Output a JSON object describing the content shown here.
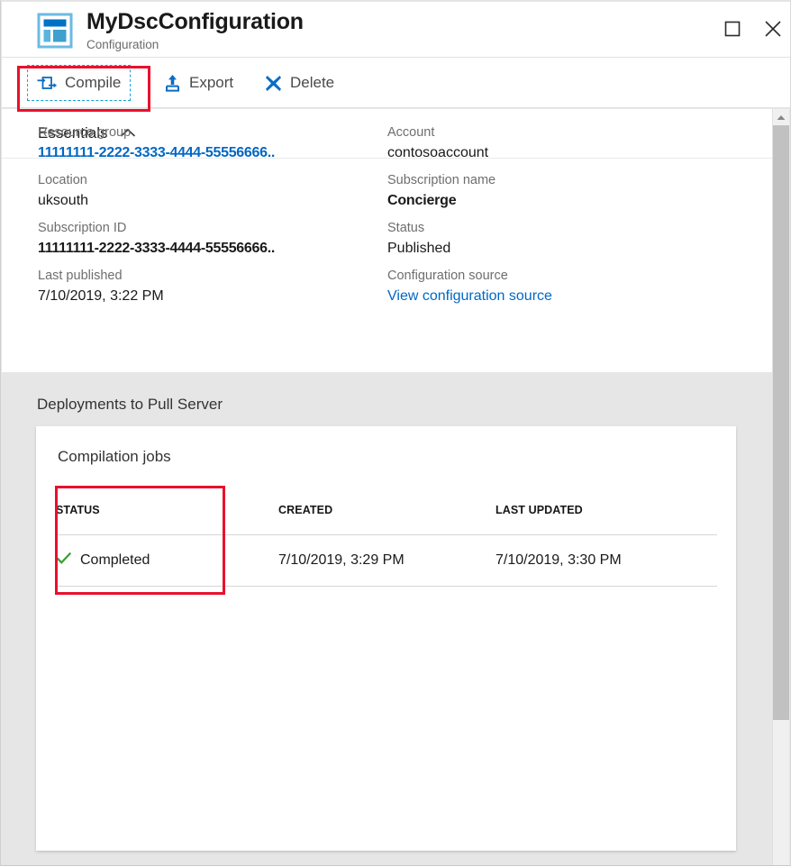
{
  "window": {
    "title": "MyDscConfiguration",
    "subtitle": "Configuration",
    "maximize_label": "Maximize",
    "close_label": "Close"
  },
  "toolbar": {
    "items": [
      {
        "label": "Compile",
        "icon": "compile-icon"
      },
      {
        "label": "Export",
        "icon": "upload-icon"
      },
      {
        "label": "Delete",
        "icon": "x-icon"
      }
    ]
  },
  "essentials": {
    "header": "Essentials",
    "chevron": "chevron-up-icon",
    "left_properties": [
      {
        "label": "Resource group",
        "value": "11111111-2222-3333-4444-55556666..",
        "style": "linkbold"
      },
      {
        "label": "Location",
        "value": "uksouth",
        "style": "plain"
      },
      {
        "label": "Subscription ID",
        "value": "11111111-2222-3333-4444-55556666..",
        "style": "bold"
      },
      {
        "label": "Last published",
        "value": "7/10/2019, 3:22 PM",
        "style": "plain"
      }
    ],
    "right_properties": [
      {
        "label": "Account",
        "value": "contosoaccount",
        "style": "plain"
      },
      {
        "label": "Subscription name",
        "value": "Concierge",
        "style": "strongnarrow"
      },
      {
        "label": "Status",
        "value": "Published",
        "style": "plain"
      },
      {
        "label": "Configuration source",
        "value": "View configuration source",
        "style": "link"
      }
    ]
  },
  "deployments": {
    "section_title": "Deployments to Pull Server",
    "card_title": "Compilation jobs",
    "table": {
      "columns": [
        "STATUS",
        "CREATED",
        "LAST UPDATED"
      ],
      "rows": [
        {
          "status": "Completed",
          "status_icon": "check-icon",
          "created": "7/10/2019, 3:29 PM",
          "last_updated": "7/10/2019, 3:30 PM"
        }
      ]
    }
  },
  "colors": {
    "accent_blue": "#0067c5",
    "link_blue": "#0067c5",
    "annotation_red": "#e8112d",
    "focus_outline": "#16a0d8",
    "success_green": "#3d9b35",
    "icon_blue": "#0a6cc4",
    "page_background": "#e6e6e6"
  },
  "scrollbar": {
    "up_arrow": "caret-up-icon"
  }
}
